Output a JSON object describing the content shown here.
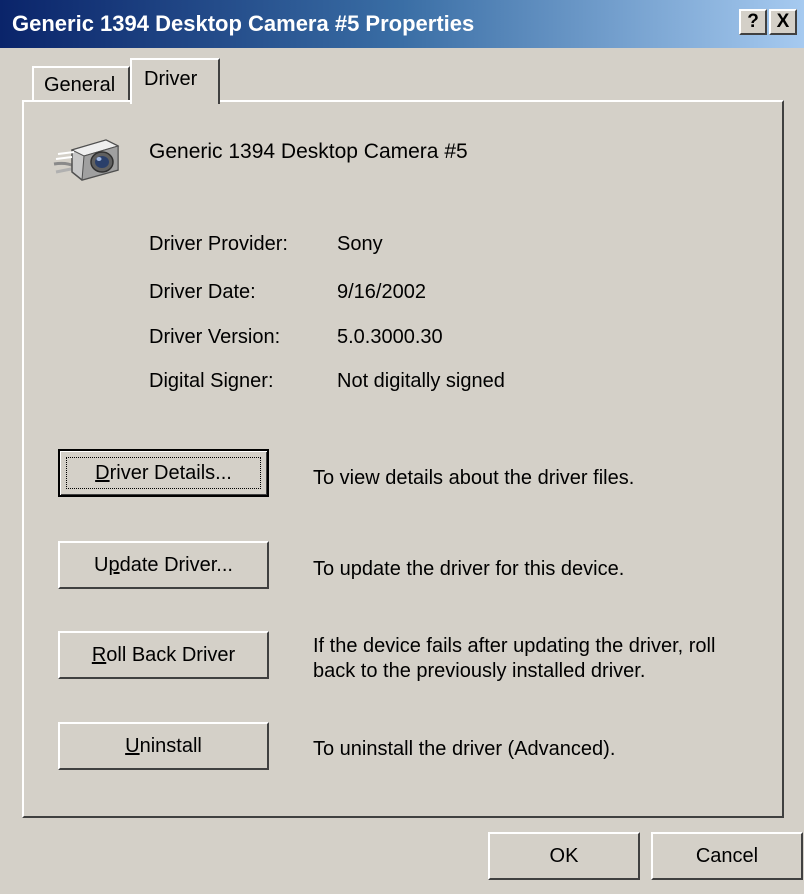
{
  "window": {
    "title": "Generic 1394 Desktop Camera #5 Properties",
    "help_glyph": "?",
    "close_glyph": "X"
  },
  "tabs": [
    {
      "label": "General",
      "active": false
    },
    {
      "label": "Driver",
      "active": true
    }
  ],
  "device": {
    "icon": "camera-icon",
    "name": "Generic 1394 Desktop Camera #5"
  },
  "info": [
    {
      "label": "Driver Provider:",
      "value": "Sony"
    },
    {
      "label": "Driver Date:",
      "value": "9/16/2002"
    },
    {
      "label": "Driver Version:",
      "value": "5.0.3000.30"
    },
    {
      "label": "Digital Signer:",
      "value": "Not digitally signed"
    }
  ],
  "actions": [
    {
      "pre": "",
      "mnemonic": "D",
      "post": "river Details...",
      "description": "To view details about the driver files."
    },
    {
      "pre": "U",
      "mnemonic": "p",
      "post": "date Driver...",
      "description": "To update the driver for this device."
    },
    {
      "pre": "",
      "mnemonic": "R",
      "post": "oll Back Driver",
      "description": "If the device fails after updating the driver, roll back to the previously installed driver."
    },
    {
      "pre": "",
      "mnemonic": "U",
      "post": "ninstall",
      "description": "To uninstall the driver (Advanced)."
    }
  ],
  "footer": {
    "ok_label": "OK",
    "cancel_label": "Cancel"
  },
  "colors": {
    "titlebar_start": "#0a246a",
    "titlebar_end": "#a6caf0",
    "face": "#d4d0c8"
  }
}
